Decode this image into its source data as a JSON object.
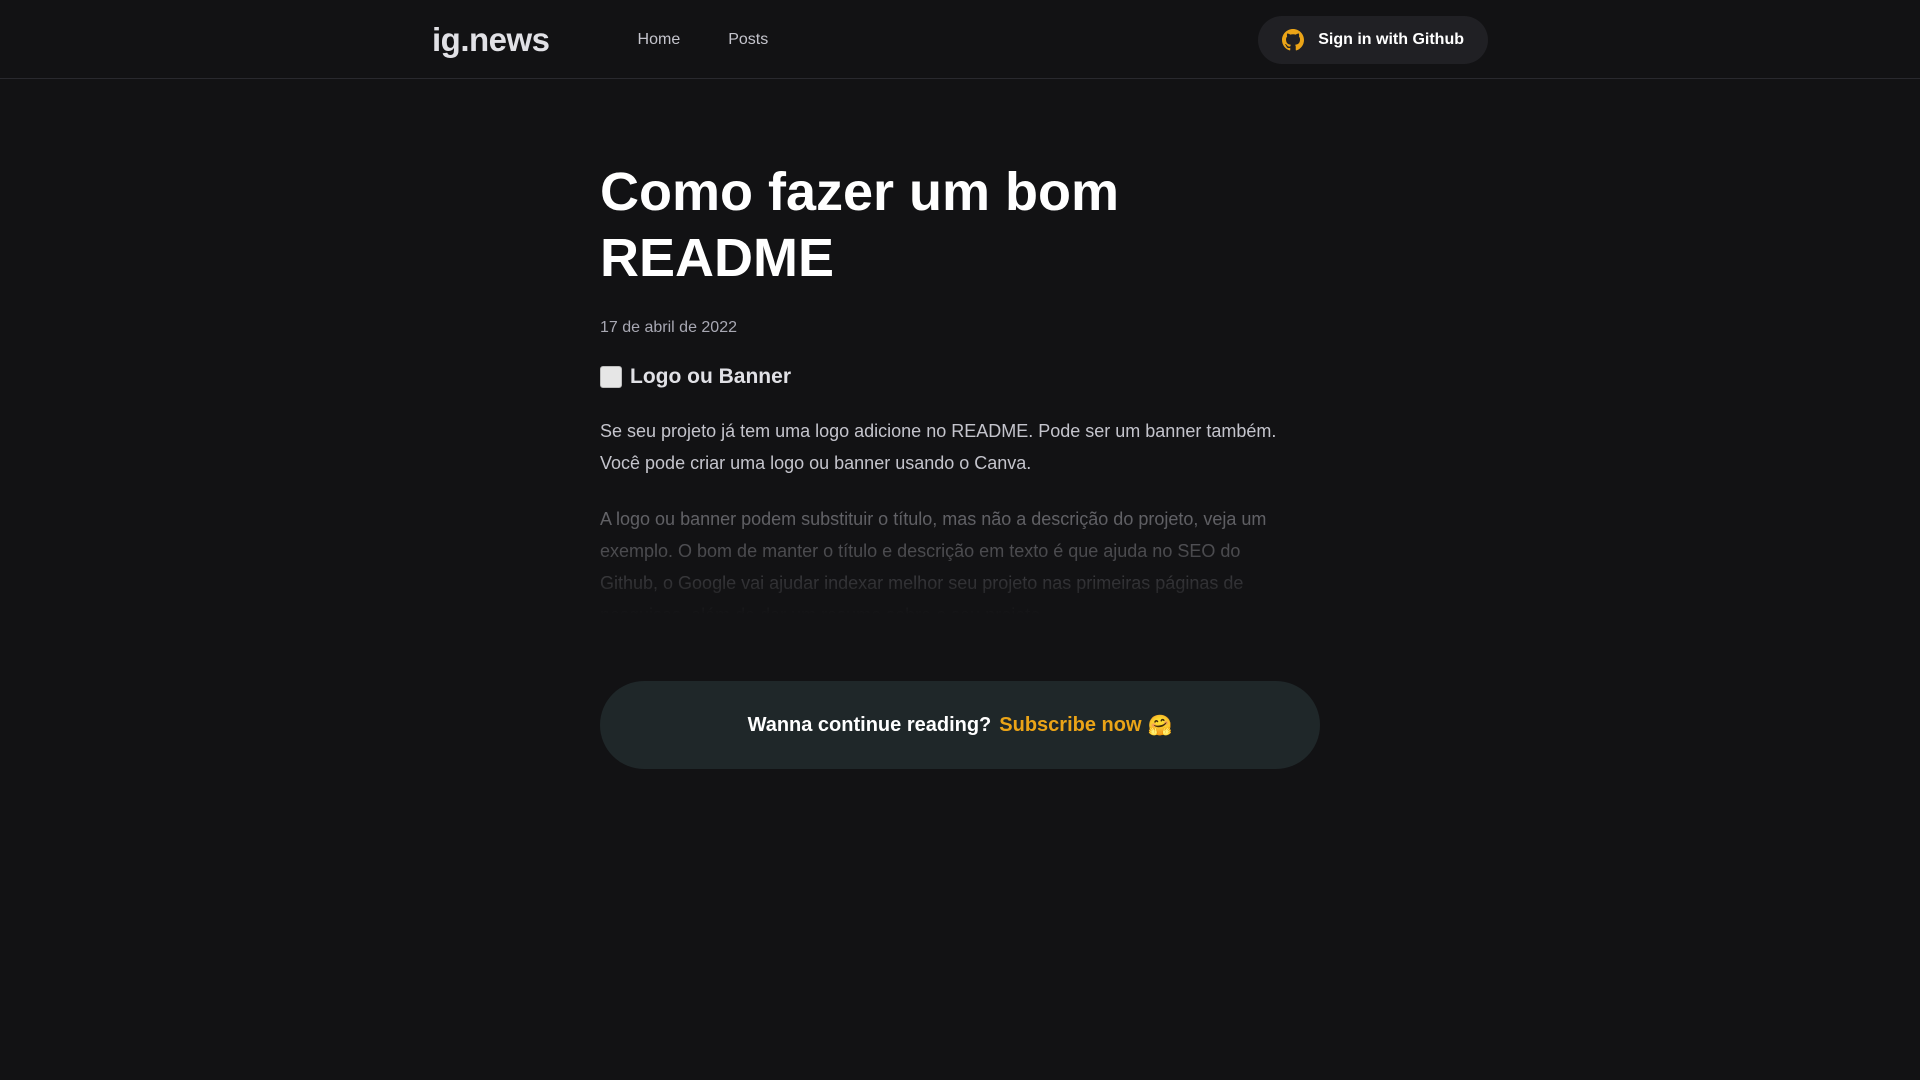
{
  "header": {
    "logo": "ig.news",
    "nav": [
      {
        "label": "Home"
      },
      {
        "label": "Posts"
      }
    ],
    "signin_label": "Sign in with Github",
    "signin_icon": "github-icon",
    "signin_icon_color": "#eba417"
  },
  "post": {
    "title": "Como fazer um bom README",
    "date": "17 de abril de 2022",
    "section_icon": "white-square-icon",
    "section_title": "Logo ou Banner",
    "paragraph1": "Se seu projeto já tem uma logo adicione no README. Pode ser um banner também. Você pode criar uma logo ou banner usando o Canva.",
    "paragraph2": "A logo ou banner podem substituir o título, mas não a descrição do projeto, veja um exemplo. O bom de manter o título e descrição em texto é que ajuda no SEO do Github, o Google vai ajudar indexar melhor seu projeto nas primeiras páginas de pesquisas, além de dar um resumo sobre o seu projeto."
  },
  "continue_reading": {
    "text": "Wanna continue reading?",
    "link": "Subscribe now",
    "emoji": "🤗"
  },
  "colors": {
    "background": "#121214",
    "accent": "#eba417",
    "card": "#1f2729"
  }
}
